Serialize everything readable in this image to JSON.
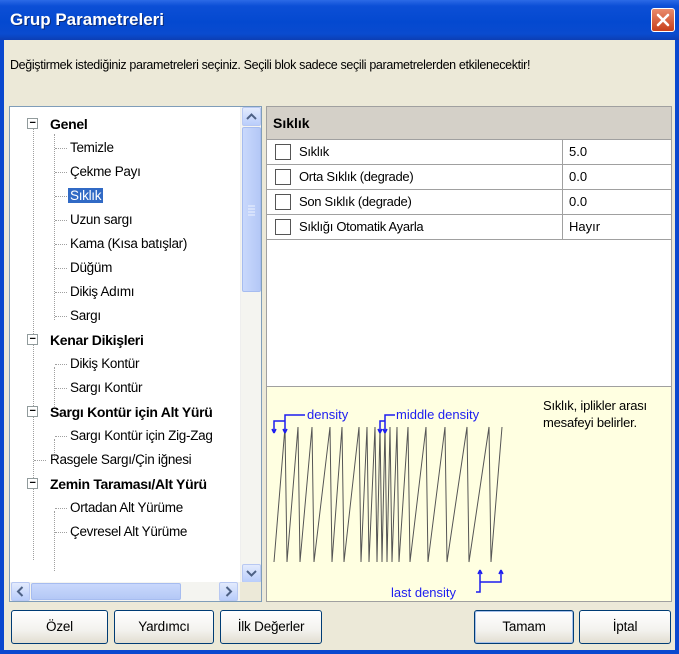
{
  "window": {
    "title": "Grup Parametreleri"
  },
  "instruction": "Değiştirmek istediğiniz parametreleri seçiniz. Seçili blok sadece seçili parametrelerden etkilenecektir!",
  "tree": {
    "expander_symbol": "−",
    "items": [
      {
        "label": "Genel",
        "level": 0,
        "category": true
      },
      {
        "label": "Temizle",
        "level": 1
      },
      {
        "label": "Çekme Payı",
        "level": 1
      },
      {
        "label": "Sıklık",
        "level": 1,
        "selected": true
      },
      {
        "label": "Uzun sargı",
        "level": 1
      },
      {
        "label": "Kama (Kısa batışlar)",
        "level": 1
      },
      {
        "label": "Düğüm",
        "level": 1
      },
      {
        "label": "Dikiş Adımı",
        "level": 1
      },
      {
        "label": "Sargı",
        "level": 1
      },
      {
        "label": "Kenar Dikişleri",
        "level": 0,
        "category": true
      },
      {
        "label": "Dikiş Kontür",
        "level": 1
      },
      {
        "label": "Sargı Kontür",
        "level": 1
      },
      {
        "label": "Sargı Kontür için Alt Yürü",
        "level": 0,
        "category": true
      },
      {
        "label": "Sargı Kontür için Zig-Zag",
        "level": 1
      },
      {
        "label": "Rasgele Sargı/Çin iğnesi",
        "level": 0
      },
      {
        "label": "Zemin Taraması/Alt Yürü",
        "level": 0,
        "category": true
      },
      {
        "label": "Ortadan Alt Yürüme",
        "level": 1
      },
      {
        "label": "Çevresel Alt Yürüme",
        "level": 1
      }
    ]
  },
  "properties": {
    "header": "Sıklık",
    "rows": [
      {
        "name": "Sıklık",
        "value": "5.0"
      },
      {
        "name": "Orta Sıklık (degrade)",
        "value": "0.0"
      },
      {
        "name": "Son Sıklık (degrade)",
        "value": "0.0"
      },
      {
        "name": "Sıklığı Otomatik Ayarla",
        "value": "Hayır"
      }
    ]
  },
  "info": {
    "description": "Sıklık, iplikler arası mesafeyi belirler.",
    "labels": {
      "density": "density",
      "middle_density": "middle density",
      "last_density": "last density"
    }
  },
  "buttons": {
    "custom": "Özel",
    "helper": "Yardımcı",
    "defaults": "İlk Değerler",
    "ok": "Tamam",
    "cancel": "İptal"
  },
  "colors": {
    "title_bar": "#0449d0",
    "selection": "#316ac5",
    "info_background": "#ffffe1",
    "diagram_label": "#1d1df0"
  }
}
